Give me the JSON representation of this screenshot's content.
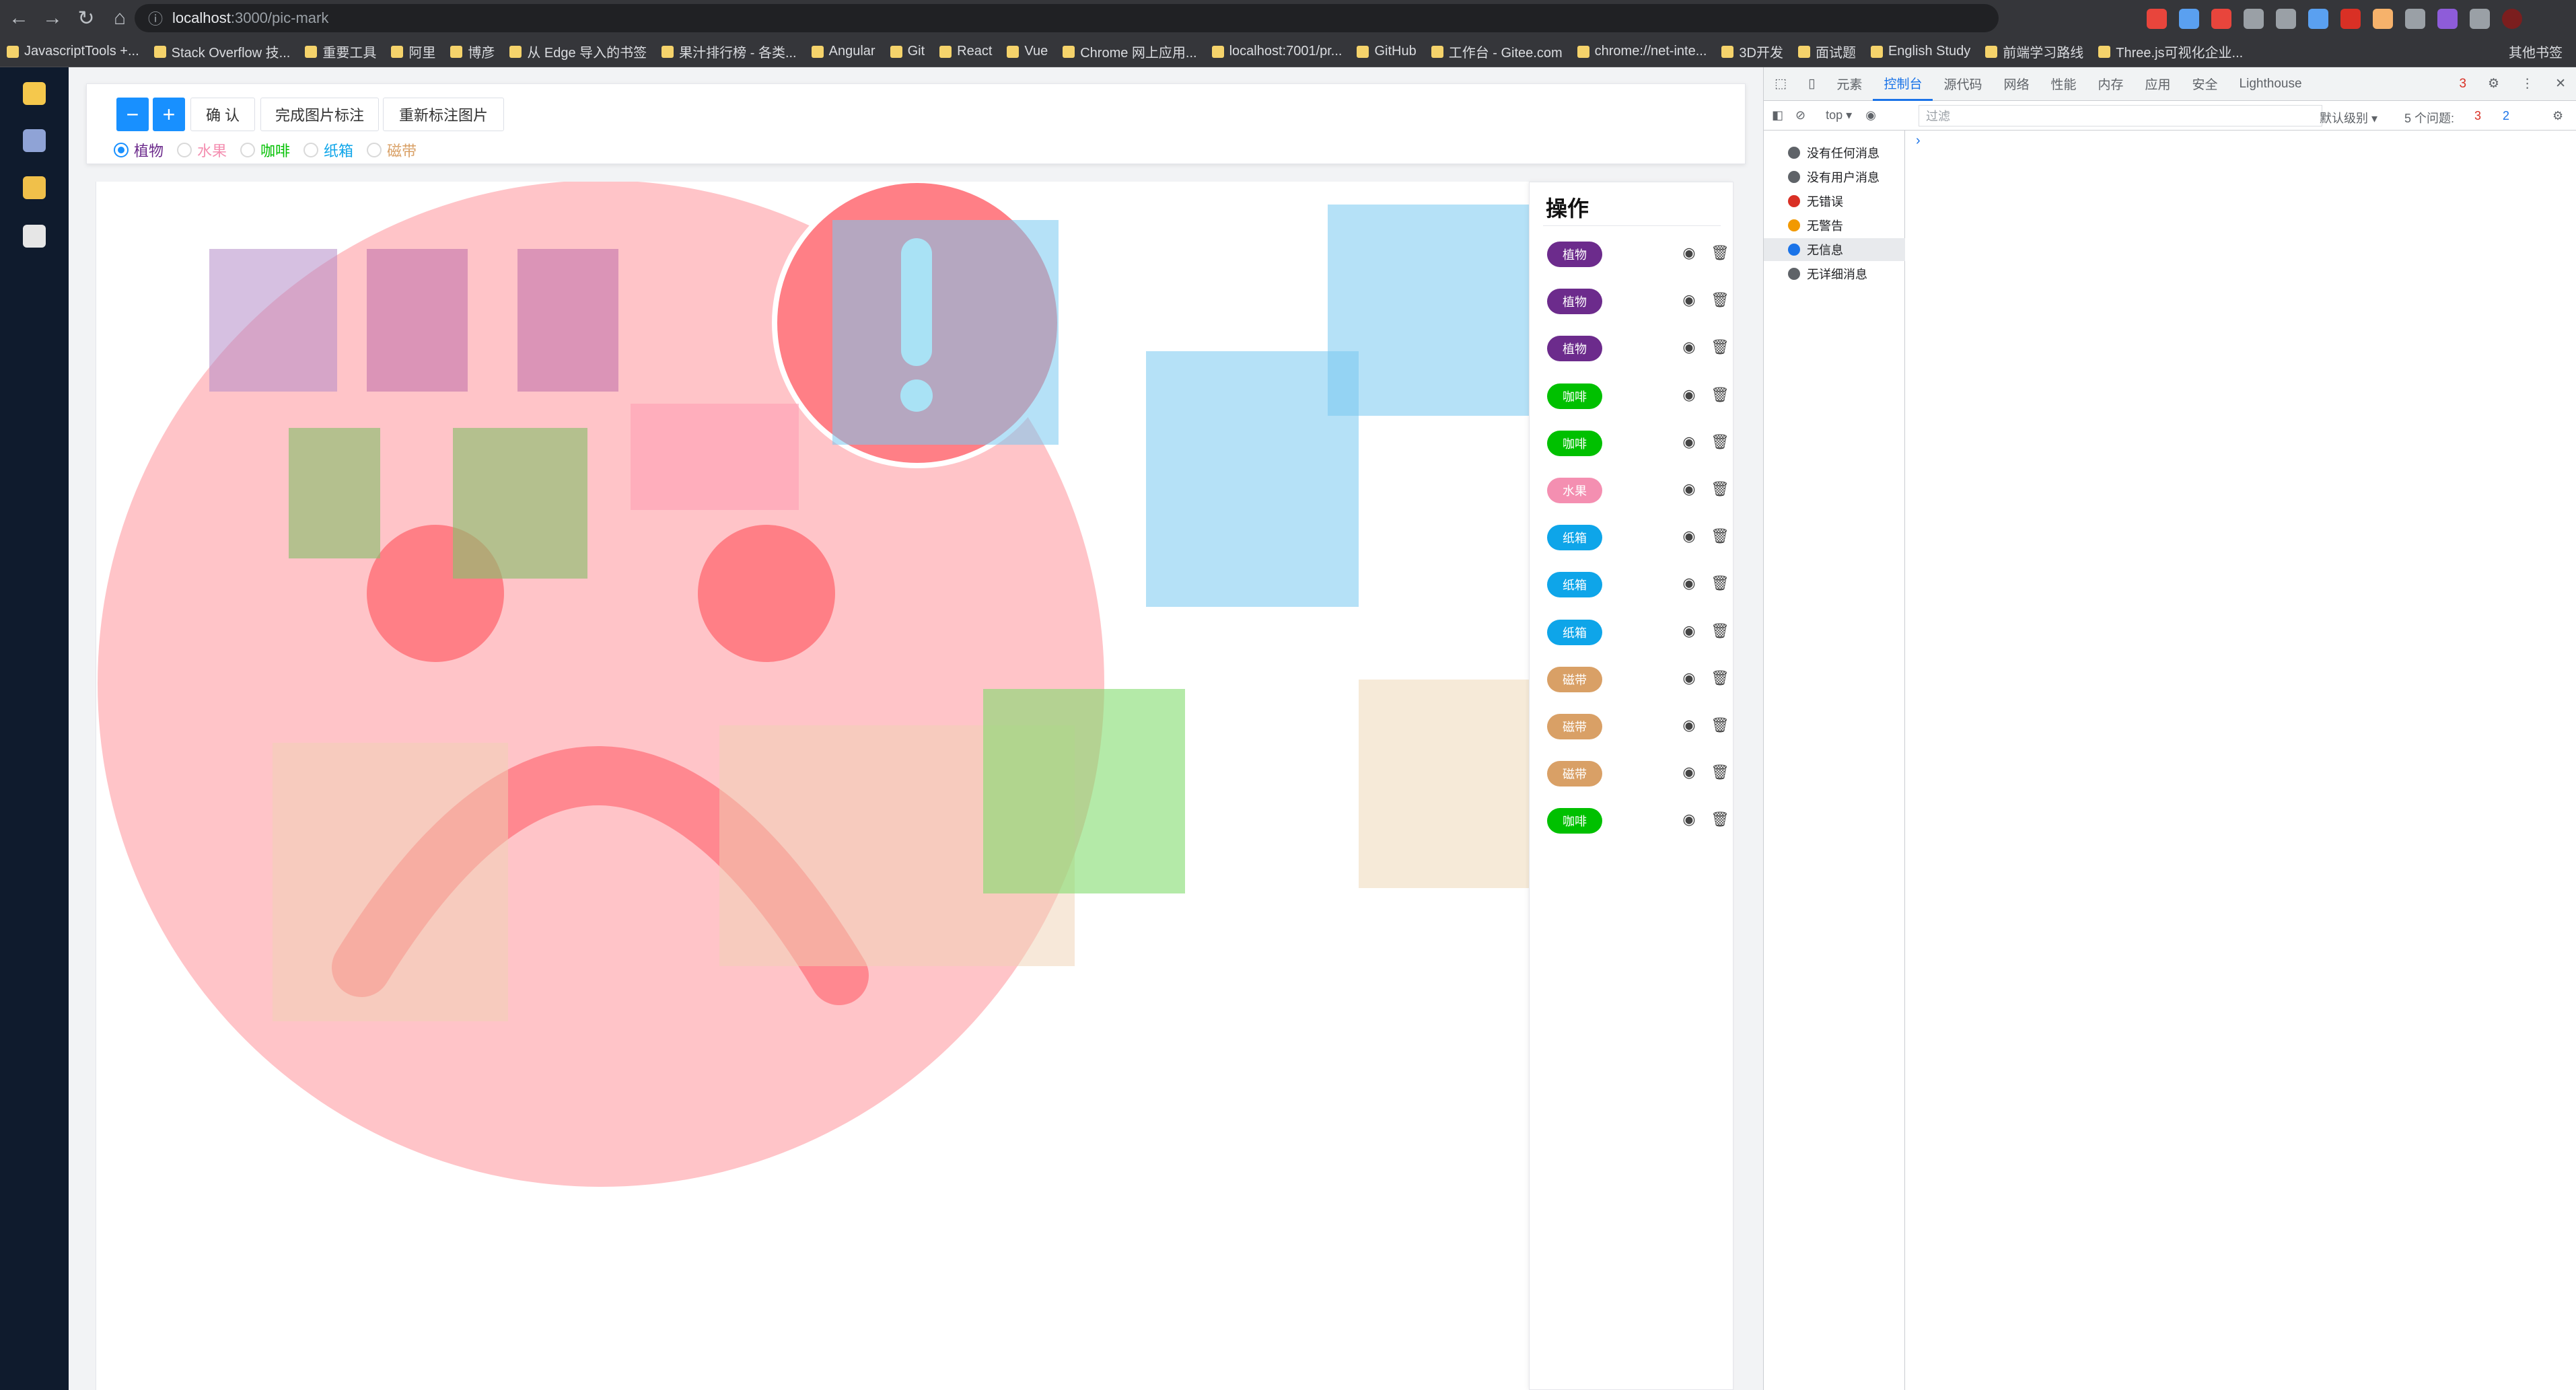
{
  "browser": {
    "url_host": "localhost",
    "url_path": ":3000/pic-mark",
    "bookmarks": [
      "JavascriptTools +...",
      "Stack Overflow 技...",
      "重要工具",
      "阿里",
      "博彦",
      "从 Edge 导入的书签",
      "果汁排行榜 - 各类...",
      "Angular",
      "Git",
      "React",
      "Vue",
      "Chrome 网上应用...",
      "localhost:7001/pr...",
      "GitHub",
      "工作台 - Gitee.com",
      "chrome://net-inte...",
      "3D开发",
      "面试题",
      "English Study",
      "前端学习路线",
      "Three.js可视化企业..."
    ],
    "other_bookmarks": "其他书签"
  },
  "toolbar": {
    "minus": "−",
    "plus": "+",
    "confirm": "确 认",
    "finish": "完成图片标注",
    "reset": "重新标注图片"
  },
  "categories": [
    {
      "label": "植物",
      "color": "#6c2b8c"
    },
    {
      "label": "水果",
      "color": "#f48fb1"
    },
    {
      "label": "咖啡",
      "color": "#00c000"
    },
    {
      "label": "纸箱",
      "color": "#0ea5e9"
    },
    {
      "label": "磁带",
      "color": "#d9a066"
    }
  ],
  "selected_category": "植物",
  "panel": {
    "title": "操作",
    "rows": [
      {
        "tag": "植物",
        "color": "#6c2b8c"
      },
      {
        "tag": "植物",
        "color": "#6c2b8c"
      },
      {
        "tag": "植物",
        "color": "#6c2b8c"
      },
      {
        "tag": "咖啡",
        "color": "#00c000"
      },
      {
        "tag": "咖啡",
        "color": "#00c000"
      },
      {
        "tag": "水果",
        "color": "#f48fb1"
      },
      {
        "tag": "纸箱",
        "color": "#0ea5e9"
      },
      {
        "tag": "纸箱",
        "color": "#0ea5e9"
      },
      {
        "tag": "纸箱",
        "color": "#0ea5e9"
      },
      {
        "tag": "磁带",
        "color": "#d9a066"
      },
      {
        "tag": "磁带",
        "color": "#d9a066"
      },
      {
        "tag": "磁带",
        "color": "#d9a066"
      },
      {
        "tag": "咖啡",
        "color": "#00c000"
      }
    ]
  },
  "devtools": {
    "tabs": [
      "元素",
      "控制台",
      "源代码",
      "网络",
      "性能",
      "内存",
      "应用",
      "安全",
      "Lighthouse"
    ],
    "active_tab": "控制台",
    "error_badge": "3",
    "context": "top",
    "filter_placeholder": "过滤",
    "level": "默认级别",
    "issues": "5 个问题:",
    "issues_err": "3",
    "issues_info": "2",
    "sidebar": [
      "没有任何消息",
      "没有用户消息",
      "无错误",
      "无警告",
      "无信息",
      "无详细消息"
    ]
  }
}
